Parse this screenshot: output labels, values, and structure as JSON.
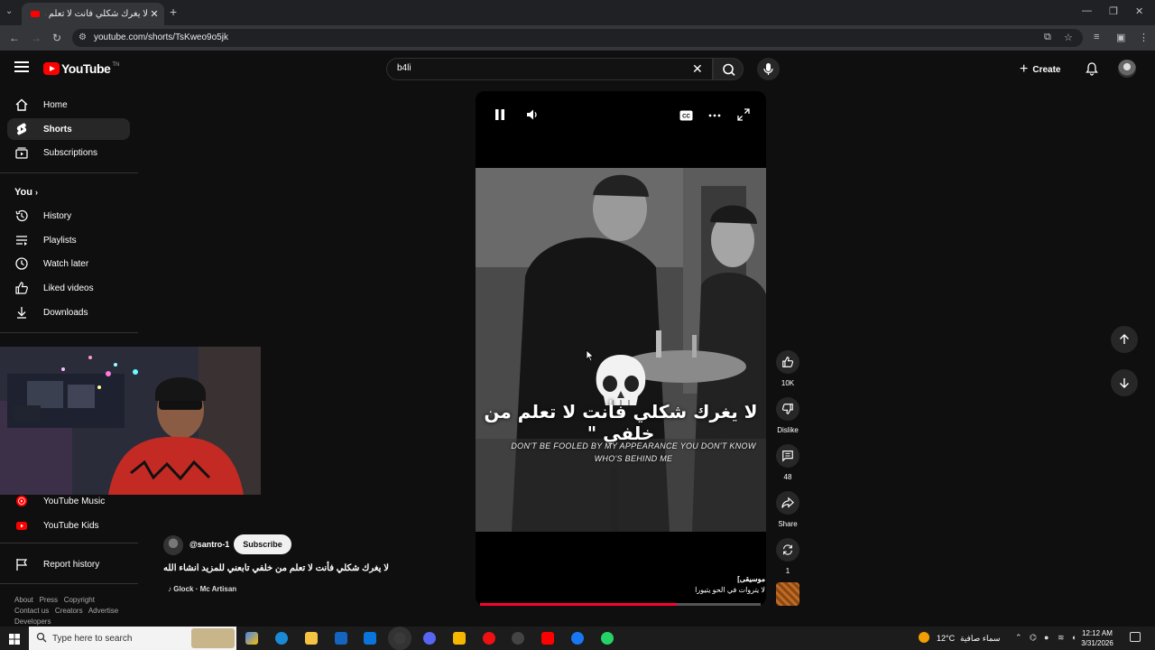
{
  "browser": {
    "tab_title": "لا يغرك شكلي فأنت لا تعلم م...",
    "url": "youtube.com/shorts/TsKweo9o5jk"
  },
  "header": {
    "logo_text": "YouTube",
    "logo_sup": "TN",
    "search_value": "b4li",
    "create_label": "Create"
  },
  "sidebar": {
    "main": [
      {
        "label": "Home",
        "icon": "home-icon"
      },
      {
        "label": "Shorts",
        "icon": "shorts-icon"
      },
      {
        "label": "Subscriptions",
        "icon": "subscriptions-icon"
      }
    ],
    "you_label": "You",
    "you_items": [
      {
        "label": "History",
        "icon": "history-icon"
      },
      {
        "label": "Playlists",
        "icon": "playlists-icon"
      },
      {
        "label": "Watch later",
        "icon": "watch-later-icon"
      },
      {
        "label": "Liked videos",
        "icon": "liked-icon"
      },
      {
        "label": "Downloads",
        "icon": "download-icon"
      }
    ],
    "more": [
      {
        "label": "YouTube Music",
        "icon": "youtube-music-icon"
      },
      {
        "label": "YouTube Kids",
        "icon": "youtube-kids-icon"
      }
    ],
    "report": "Report history",
    "footer": {
      "line1": [
        "About",
        "Press",
        "Copyright"
      ],
      "line2": [
        "Contact us",
        "Creators",
        "Advertise"
      ],
      "line3": [
        "Developers"
      ]
    }
  },
  "video": {
    "channel": "@santro-1",
    "subscribe_label": "Subscribe",
    "title": "لا يغرك شكلي فأنت لا تعلم من خلفي تابعني للمزيد انشاء الله",
    "music": "Glock · Mc Artisan",
    "caption_ar": "لا يغرك شكلي فأنت لا تعلم من خلفي \"",
    "caption_en_1": "Don't be fooled by my appearance you don't know",
    "caption_en_2": "who's behind me",
    "sound_line1": "موسيقى]",
    "sound_line2": "لا يتروات في الحو يتيورا",
    "progress": 0.7
  },
  "actions": {
    "like_count": "10K",
    "dislike_label": "Dislike",
    "comments_count": "48",
    "share_label": "Share",
    "remix_count": "1"
  },
  "taskbar": {
    "search_placeholder": "Type here to search",
    "temperature": "12°C",
    "weather_desc": "سماء صافية",
    "time": "12:12 AM",
    "date": "3/31/2026"
  },
  "colors": {
    "background": "#0f0f0f",
    "accent": "#ff0000",
    "progress": "#ff0033"
  }
}
